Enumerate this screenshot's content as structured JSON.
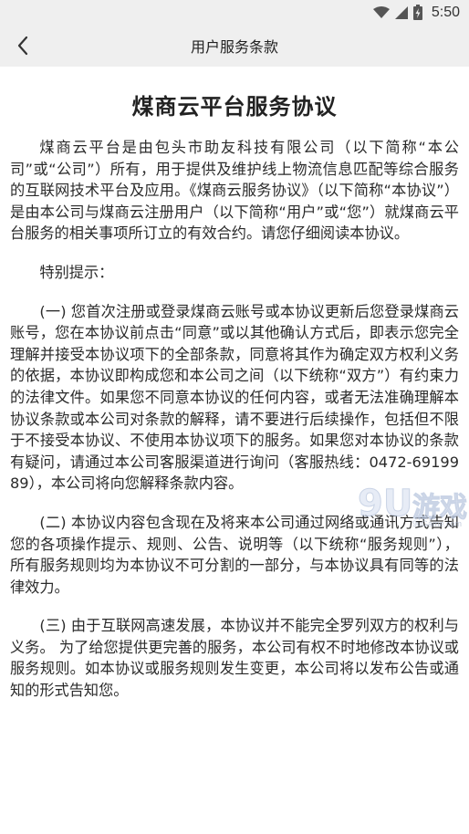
{
  "status_bar": {
    "time": "5:50",
    "icons": [
      "wifi-icon",
      "cellular-signal-icon",
      "battery-charging-icon"
    ]
  },
  "header": {
    "title": "用户服务条款",
    "back_icon": "chevron-left-icon"
  },
  "document": {
    "title": "煤商云平台服务协议",
    "intro": "煤商云平台是由包头市助友科技有限公司（以下简称“本公司”或“公司”）所有，用于提供及维护线上物流信息匹配等综合服务的互联网技术平台及应用。《煤商云服务协议》（以下简称“本协议”）是由本公司与煤商云注册用户（以下简称“用户”或“您”）就煤商云平台服务的相关事项所订立的有效合约。请您仔细阅读本协议。",
    "special_notice": "特别提示：",
    "clause_1": "(一) 您首次注册或登录煤商云账号或本协议更新后您登录煤商云账号，您在本协议前点击“同意”或以其他确认方式后，即表示您完全理解并接受本协议项下的全部条款，同意将其作为确定双方权利义务的依据，本协议即构成您和本公司之间（以下统称“双方”）有约束力的法律文件。如果您不同意本协议的任何内容，或者无法准确理解本协议条款或本公司对条款的解释，请不要进行后续操作，包括但不限于不接受本协议、不使用本协议项下的服务。如果您对本协议的条款有疑问，请通过本公司客服渠道进行询问（客服热线：0472-6919989），本公司将向您解释条款内容。",
    "clause_2": "(二) 本协议内容包含现在及将来本公司通过网络或通讯方式告知您的各项操作提示、规则、公告、说明等（以下统称“服务规则”），所有服务规则均为本协议不可分割的一部分，与本协议具有同等的法律效力。",
    "clause_3": "(三) 由于互联网高速发展，本协议并不能完全罗列双方的权利与义务。 为了给您提供更完善的服务，本公司有权不时地修改本协议或服务规则。如本协议或服务规则发生变更，本公司将以发布公告或通知的形式告知您。"
  },
  "watermark": {
    "logo": "9U",
    "text": "游戏",
    "url": "9uGame.com"
  }
}
